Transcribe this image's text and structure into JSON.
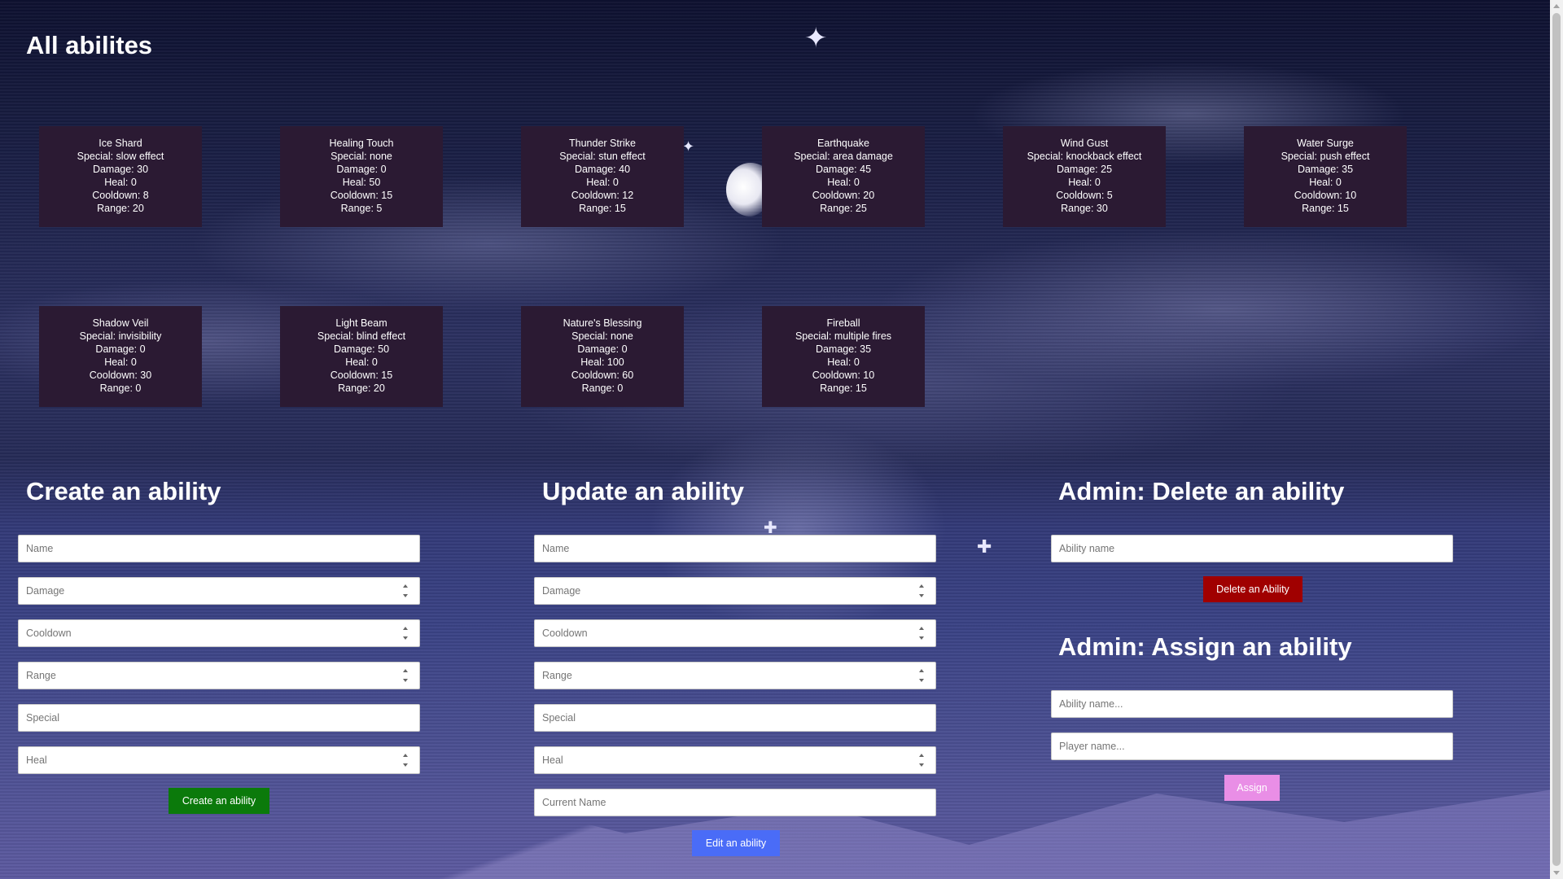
{
  "page_title": "All abilites",
  "abilities": [
    {
      "name": "Ice Shard",
      "special": "Special: slow effect",
      "damage": "Damage: 30",
      "heal": "Heal: 0",
      "cooldown": "Cooldown: 8",
      "range": "Range: 20"
    },
    {
      "name": "Healing Touch",
      "special": "Special: none",
      "damage": "Damage: 0",
      "heal": "Heal: 50",
      "cooldown": "Cooldown: 15",
      "range": "Range: 5"
    },
    {
      "name": "Thunder Strike",
      "special": "Special: stun effect",
      "damage": "Damage: 40",
      "heal": "Heal: 0",
      "cooldown": "Cooldown: 12",
      "range": "Range: 15"
    },
    {
      "name": "Earthquake",
      "special": "Special: area damage",
      "damage": "Damage: 45",
      "heal": "Heal: 0",
      "cooldown": "Cooldown: 20",
      "range": "Range: 25"
    },
    {
      "name": "Wind Gust",
      "special": "Special: knockback effect",
      "damage": "Damage: 25",
      "heal": "Heal: 0",
      "cooldown": "Cooldown: 5",
      "range": "Range: 30"
    },
    {
      "name": "Water Surge",
      "special": "Special: push effect",
      "damage": "Damage: 35",
      "heal": "Heal: 0",
      "cooldown": "Cooldown: 10",
      "range": "Range: 15"
    },
    {
      "name": "Shadow Veil",
      "special": "Special: invisibility",
      "damage": "Damage: 0",
      "heal": "Heal: 0",
      "cooldown": "Cooldown: 30",
      "range": "Range: 0"
    },
    {
      "name": "Light Beam",
      "special": "Special: blind effect",
      "damage": "Damage: 50",
      "heal": "Heal: 0",
      "cooldown": "Cooldown: 15",
      "range": "Range: 20"
    },
    {
      "name": "Nature's Blessing",
      "special": "Special: none",
      "damage": "Damage: 0",
      "heal": "Heal: 100",
      "cooldown": "Cooldown: 60",
      "range": "Range: 0"
    },
    {
      "name": "Fireball",
      "special": "Special: multiple fires",
      "damage": "Damage: 35",
      "heal": "Heal: 0",
      "cooldown": "Cooldown: 10",
      "range": "Range: 15"
    }
  ],
  "create": {
    "title": "Create an ability",
    "name_placeholder": "Name",
    "damage_placeholder": "Damage",
    "cooldown_placeholder": "Cooldown",
    "range_placeholder": "Range",
    "special_placeholder": "Special",
    "heal_placeholder": "Heal",
    "button_label": "Create an ability"
  },
  "update": {
    "title": "Update an ability",
    "name_placeholder": "Name",
    "damage_placeholder": "Damage",
    "cooldown_placeholder": "Cooldown",
    "range_placeholder": "Range",
    "special_placeholder": "Special",
    "heal_placeholder": "Heal",
    "current_name_placeholder": "Current Name",
    "button_label": "Edit an ability"
  },
  "delete": {
    "title": "Admin: Delete an ability",
    "ability_placeholder": "Ability name",
    "button_label": "Delete an Ability"
  },
  "assign": {
    "title": "Admin: Assign an ability",
    "ability_placeholder": "Ability name...",
    "player_placeholder": "Player name...",
    "button_label": "Assign"
  },
  "colors": {
    "card_bg": "#2b1a33",
    "create_button": "#0b7a0b",
    "edit_button": "#4a6cf7",
    "delete_button": "#a00000",
    "assign_button": "#e98ee6"
  }
}
